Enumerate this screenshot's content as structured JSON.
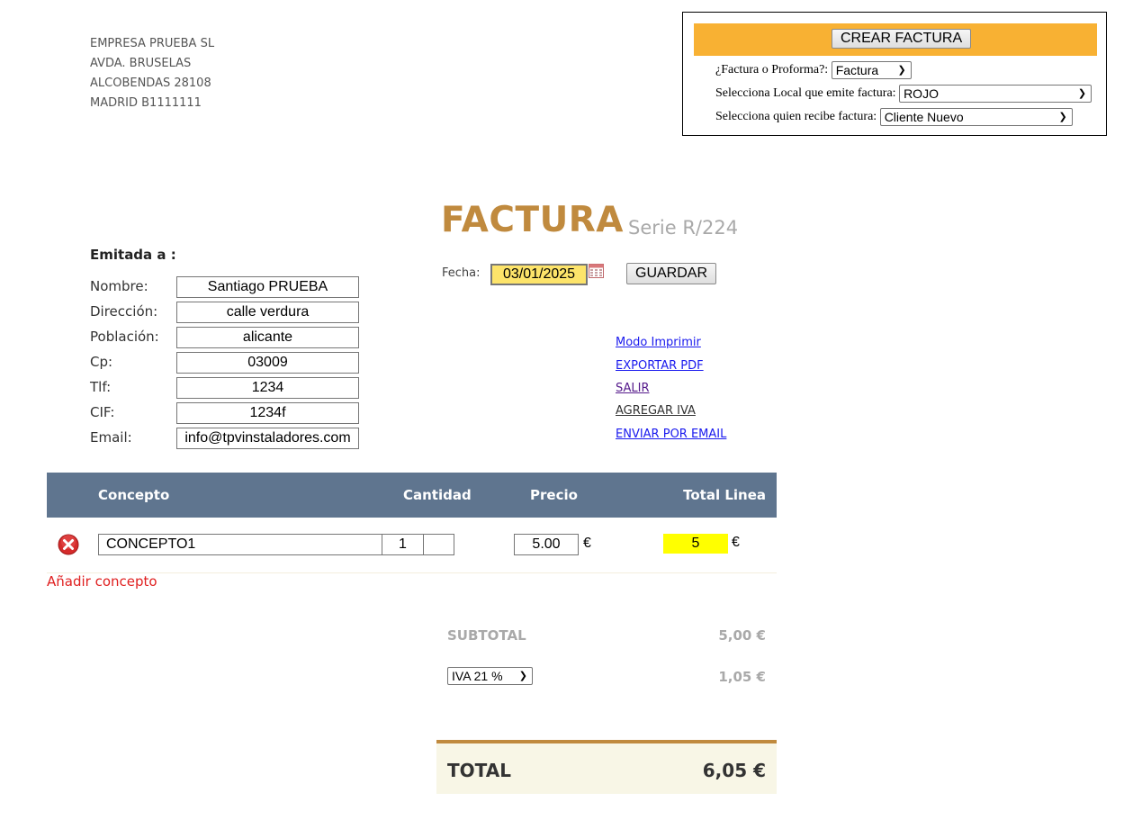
{
  "company": {
    "lines": [
      "EMPRESA PRUEBA SL",
      "AVDA. BRUSELAS",
      "ALCOBENDAS 28108",
      "MADRID B1111111"
    ]
  },
  "panel": {
    "create_button": "CREAR FACTURA",
    "type_label": "¿Factura o Proforma?:",
    "type_value": "Factura",
    "local_label": "Selecciona Local que emite factura:",
    "local_value": "ROJO",
    "receiver_label": "Selecciona quien recibe factura:",
    "receiver_value": "Cliente Nuevo"
  },
  "header": {
    "title": "FACTURA",
    "serie": "Serie R/224",
    "fecha_label": "Fecha:",
    "fecha_value": "03/01/2025",
    "guardar": "GUARDAR"
  },
  "client": {
    "heading": "Emitada a :",
    "fields": [
      {
        "label": "Nombre:",
        "value": "Santiago PRUEBA"
      },
      {
        "label": "Dirección:",
        "value": "calle verdura"
      },
      {
        "label": "Población:",
        "value": "alicante"
      },
      {
        "label": "Cp:",
        "value": "03009"
      },
      {
        "label": "Tlf:",
        "value": "1234"
      },
      {
        "label": "CIF:",
        "value": "1234f"
      },
      {
        "label": "Email:",
        "value": "info@tpvinstaladores.com"
      }
    ]
  },
  "links": {
    "print": "Modo Imprimir",
    "pdf": "EXPORTAR PDF",
    "exit": "SALIR",
    "iva": "AGREGAR IVA",
    "email": "ENVIAR POR EMAIL"
  },
  "colors": {
    "link_blue": "#1a1aee",
    "link_visited": "#551a8b",
    "link_dark": "#333333"
  },
  "table": {
    "headers": {
      "concepto": "Concepto",
      "cantidad": "Cantidad",
      "precio": "Precio",
      "total": "Total Linea"
    },
    "rows": [
      {
        "concepto": "CONCEPTO1",
        "cantidad": "1",
        "extra": "",
        "precio": "5.00",
        "currency": "€",
        "total": "5",
        "total_currency": "€"
      }
    ],
    "add_label": "Añadir concepto"
  },
  "totals": {
    "subtotal_label": "SUBTOTAL",
    "subtotal_value": "5,00 €",
    "iva_option": "IVA 21 %",
    "iva_value": "1,05 €",
    "total_label": "TOTAL",
    "total_value": "6,05 €"
  }
}
